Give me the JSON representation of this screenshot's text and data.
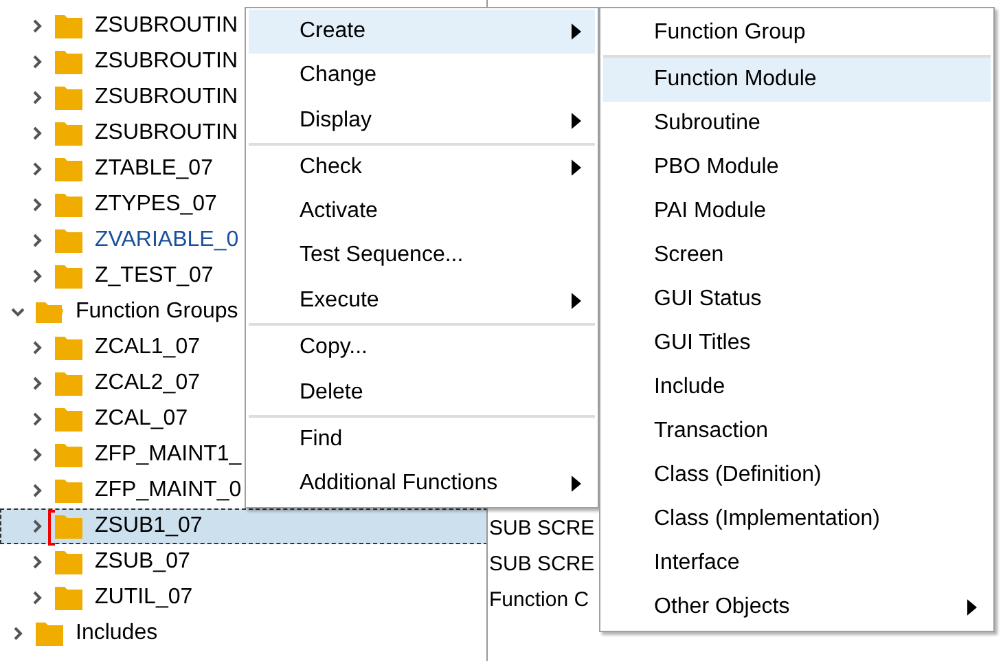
{
  "tree": [
    {
      "label": "ZSUBROUTIN",
      "expanded": false,
      "link": false,
      "selected": false
    },
    {
      "label": "ZSUBROUTIN",
      "expanded": false,
      "link": false,
      "selected": false
    },
    {
      "label": "ZSUBROUTIN",
      "expanded": false,
      "link": false,
      "selected": false
    },
    {
      "label": "ZSUBROUTIN",
      "expanded": false,
      "link": false,
      "selected": false
    },
    {
      "label": "ZTABLE_07",
      "expanded": false,
      "link": false,
      "selected": false
    },
    {
      "label": "ZTYPES_07",
      "expanded": false,
      "link": false,
      "selected": false
    },
    {
      "label": "ZVARIABLE_0",
      "expanded": false,
      "link": true,
      "selected": false
    },
    {
      "label": "Z_TEST_07",
      "expanded": false,
      "link": false,
      "selected": false
    },
    {
      "label": "Function Groups",
      "expanded": true,
      "link": false,
      "selected": false,
      "children": [
        {
          "label": "ZCAL1_07",
          "expanded": false,
          "link": false,
          "selected": false
        },
        {
          "label": "ZCAL2_07",
          "expanded": false,
          "link": false,
          "selected": false
        },
        {
          "label": "ZCAL_07",
          "expanded": false,
          "link": false,
          "selected": false
        },
        {
          "label": "ZFP_MAINT1_",
          "expanded": false,
          "link": false,
          "selected": false
        },
        {
          "label": "ZFP_MAINT_0",
          "expanded": false,
          "link": false,
          "selected": false
        },
        {
          "label": "ZSUB1_07",
          "expanded": false,
          "link": false,
          "selected": true,
          "column_2": "SUB SCRE"
        },
        {
          "label": "ZSUB_07",
          "expanded": false,
          "link": false,
          "selected": false,
          "column_2": "SUB SCRE"
        },
        {
          "label": "ZUTIL_07",
          "expanded": false,
          "link": false,
          "selected": false,
          "column_2": "Function C"
        }
      ]
    },
    {
      "label": "Includes",
      "expanded": false,
      "link": false,
      "selected": false
    }
  ],
  "context_menu": [
    {
      "label": "Create",
      "submenu": true,
      "selected": true,
      "separator_after": false
    },
    {
      "label": "Change",
      "submenu": false,
      "selected": false,
      "separator_after": false
    },
    {
      "label": "Display",
      "submenu": true,
      "selected": false,
      "separator_after": true
    },
    {
      "label": "Check",
      "submenu": true,
      "selected": false,
      "separator_after": false
    },
    {
      "label": "Activate",
      "submenu": false,
      "selected": false,
      "separator_after": false
    },
    {
      "label": "Test Sequence...",
      "submenu": false,
      "selected": false,
      "separator_after": false
    },
    {
      "label": "Execute",
      "submenu": true,
      "selected": false,
      "separator_after": true
    },
    {
      "label": "Copy...",
      "submenu": false,
      "selected": false,
      "separator_after": false
    },
    {
      "label": "Delete",
      "submenu": false,
      "selected": false,
      "separator_after": true
    },
    {
      "label": "Find",
      "submenu": false,
      "selected": false,
      "separator_after": false
    },
    {
      "label": "Additional Functions",
      "submenu": true,
      "selected": false,
      "separator_after": false
    }
  ],
  "create_submenu": [
    {
      "label": "Function Group",
      "submenu": false,
      "selected": false,
      "separator_after": true
    },
    {
      "label": "Function Module",
      "submenu": false,
      "selected": true,
      "separator_after": false
    },
    {
      "label": "Subroutine",
      "submenu": false,
      "selected": false,
      "separator_after": false
    },
    {
      "label": "PBO Module",
      "submenu": false,
      "selected": false,
      "separator_after": false
    },
    {
      "label": "PAI Module",
      "submenu": false,
      "selected": false,
      "separator_after": false
    },
    {
      "label": "Screen",
      "submenu": false,
      "selected": false,
      "separator_after": false
    },
    {
      "label": "GUI Status",
      "submenu": false,
      "selected": false,
      "separator_after": false
    },
    {
      "label": "GUI Titles",
      "submenu": false,
      "selected": false,
      "separator_after": false
    },
    {
      "label": "Include",
      "submenu": false,
      "selected": false,
      "separator_after": false
    },
    {
      "label": "Transaction",
      "submenu": false,
      "selected": false,
      "separator_after": false
    },
    {
      "label": "Class (Definition)",
      "submenu": false,
      "selected": false,
      "separator_after": false
    },
    {
      "label": "Class (Implementation)",
      "submenu": false,
      "selected": false,
      "separator_after": false
    },
    {
      "label": "Interface",
      "submenu": false,
      "selected": false,
      "separator_after": false
    },
    {
      "label": "Other Objects",
      "submenu": true,
      "selected": false,
      "separator_after": false
    }
  ]
}
